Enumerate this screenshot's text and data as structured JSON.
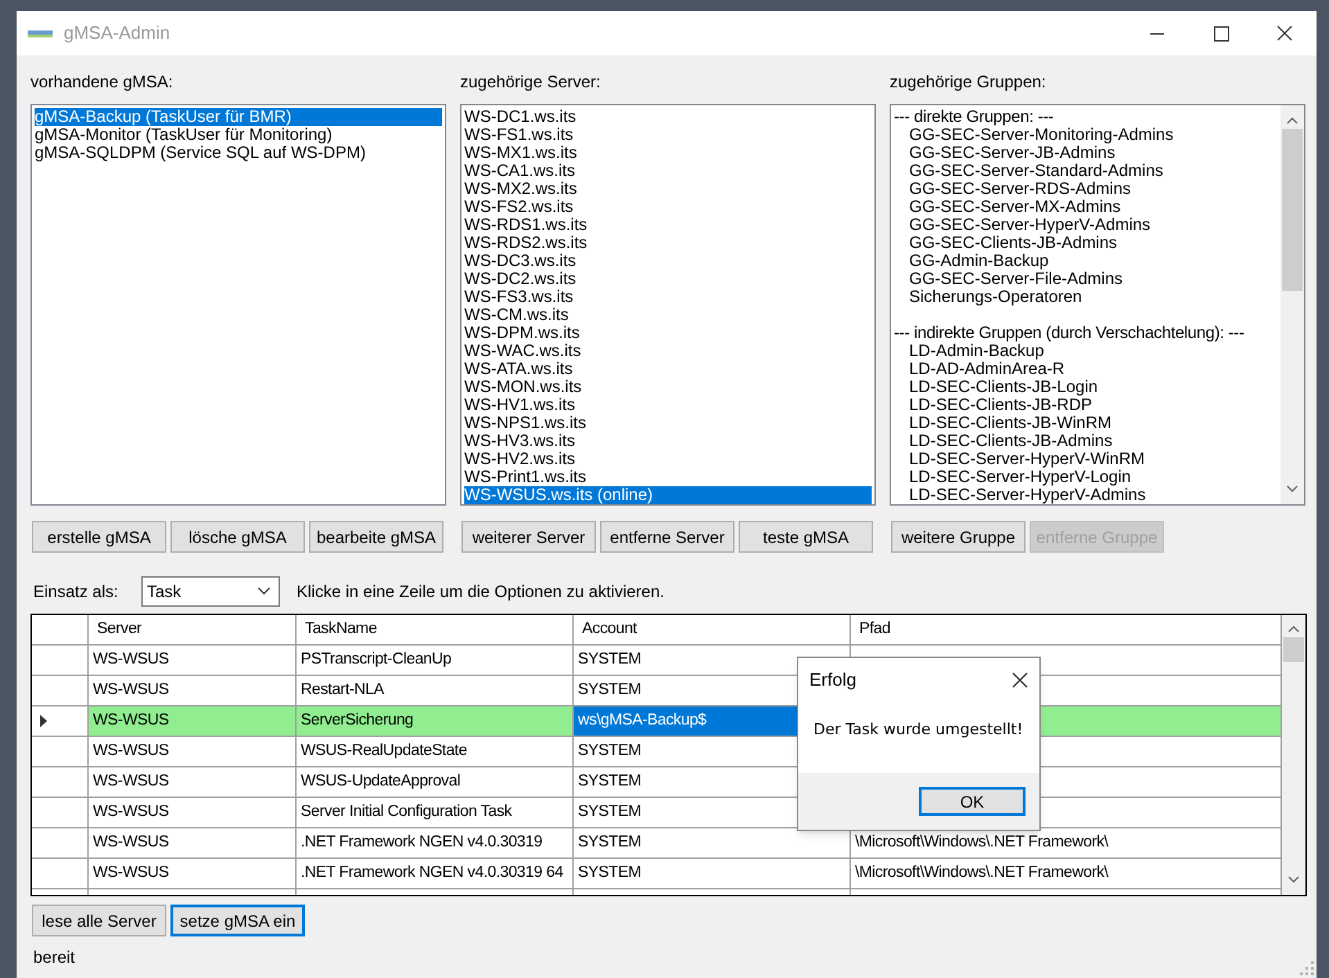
{
  "window": {
    "title": "gMSA-Admin"
  },
  "gmsa_panel": {
    "label": "vorhandene gMSA:",
    "items": [
      {
        "text": "gMSA-Backup (TaskUser für BMR)",
        "selected": true
      },
      {
        "text": "gMSA-Monitor (TaskUser für Monitoring)",
        "selected": false
      },
      {
        "text": "gMSA-SQLDPM (Service SQL auf WS-DPM)",
        "selected": false
      }
    ]
  },
  "servers_panel": {
    "label": "zugehörige Server:",
    "items": [
      {
        "text": "WS-DC1.ws.its",
        "selected": false
      },
      {
        "text": "WS-FS1.ws.its",
        "selected": false
      },
      {
        "text": "WS-MX1.ws.its",
        "selected": false
      },
      {
        "text": "WS-CA1.ws.its",
        "selected": false
      },
      {
        "text": "WS-MX2.ws.its",
        "selected": false
      },
      {
        "text": "WS-FS2.ws.its",
        "selected": false
      },
      {
        "text": "WS-RDS1.ws.its",
        "selected": false
      },
      {
        "text": "WS-RDS2.ws.its",
        "selected": false
      },
      {
        "text": "WS-DC3.ws.its",
        "selected": false
      },
      {
        "text": "WS-DC2.ws.its",
        "selected": false
      },
      {
        "text": "WS-FS3.ws.its",
        "selected": false
      },
      {
        "text": "WS-CM.ws.its",
        "selected": false
      },
      {
        "text": "WS-DPM.ws.its",
        "selected": false
      },
      {
        "text": "WS-WAC.ws.its",
        "selected": false
      },
      {
        "text": "WS-ATA.ws.its",
        "selected": false
      },
      {
        "text": "WS-MON.ws.its",
        "selected": false
      },
      {
        "text": "WS-HV1.ws.its",
        "selected": false
      },
      {
        "text": "WS-NPS1.ws.its",
        "selected": false
      },
      {
        "text": "WS-HV3.ws.its",
        "selected": false
      },
      {
        "text": "WS-HV2.ws.its",
        "selected": false
      },
      {
        "text": "WS-Print1.ws.its",
        "selected": false
      },
      {
        "text": "WS-WSUS.ws.its (online)",
        "selected": true
      }
    ]
  },
  "groups_panel": {
    "label": "zugehörige Gruppen:",
    "sections": [
      {
        "heading": "--- direkte Gruppen: ---",
        "groups": [
          "GG-SEC-Server-Monitoring-Admins",
          "GG-SEC-Server-JB-Admins",
          "GG-SEC-Server-Standard-Admins",
          "GG-SEC-Server-RDS-Admins",
          "GG-SEC-Server-MX-Admins",
          "GG-SEC-Server-HyperV-Admins",
          "GG-SEC-Clients-JB-Admins",
          "GG-Admin-Backup",
          "GG-SEC-Server-File-Admins",
          "Sicherungs-Operatoren"
        ]
      },
      {
        "heading": "--- indirekte Gruppen (durch Verschachtelung): ---",
        "groups": [
          "LD-Admin-Backup",
          "LD-AD-AdminArea-R",
          "LD-SEC-Clients-JB-Login",
          "LD-SEC-Clients-JB-RDP",
          "LD-SEC-Clients-JB-WinRM",
          "LD-SEC-Clients-JB-Admins",
          "LD-SEC-Server-HyperV-WinRM",
          "LD-SEC-Server-HyperV-Login",
          "LD-SEC-Server-HyperV-Admins"
        ]
      }
    ]
  },
  "gmsa_buttons": [
    {
      "label": "erstelle gMSA",
      "disabled": false
    },
    {
      "label": "lösche gMSA",
      "disabled": false
    },
    {
      "label": "bearbeite gMSA",
      "disabled": false
    }
  ],
  "server_buttons": [
    {
      "label": "weiterer Server",
      "disabled": false
    },
    {
      "label": "entferne Server",
      "disabled": false
    },
    {
      "label": "teste gMSA",
      "disabled": false
    }
  ],
  "group_buttons": [
    {
      "label": "weitere Gruppe",
      "disabled": false
    },
    {
      "label": "entferne Gruppe",
      "disabled": true
    }
  ],
  "usage": {
    "label": "Einsatz als:",
    "value": "Task",
    "hint": "Klicke in eine Zeile um die Optionen zu aktivieren."
  },
  "table": {
    "columns": [
      "Server",
      "TaskName",
      "Account",
      "Pfad"
    ],
    "rows": [
      {
        "server": "WS-WSUS",
        "task": "PSTranscript-CleanUp",
        "account": "SYSTEM",
        "selected": false,
        "account_focused": false
      },
      {
        "server": "WS-WSUS",
        "task": "Restart-NLA",
        "account": "SYSTEM",
        "selected": false,
        "account_focused": false
      },
      {
        "server": "WS-WSUS",
        "task": "ServerSicherung",
        "account": "ws\\gMSA-Backup$",
        "selected": true,
        "account_focused": true
      },
      {
        "server": "WS-WSUS",
        "task": "WSUS-RealUpdateState",
        "account": "SYSTEM",
        "selected": false,
        "account_focused": false
      },
      {
        "server": "WS-WSUS",
        "task": "WSUS-UpdateApproval",
        "account": "SYSTEM",
        "selected": false,
        "account_focused": false
      },
      {
        "server": "WS-WSUS",
        "task": "Server Initial Configuration Task",
        "account": "SYSTEM",
        "selected": false,
        "account_focused": false
      },
      {
        "server": "WS-WSUS",
        "task": ".NET Framework NGEN v4.0.30319",
        "account": "SYSTEM",
        "path": "\\Microsoft\\Windows\\.NET Framework\\",
        "selected": false,
        "account_focused": false
      },
      {
        "server": "WS-WSUS",
        "task": ".NET Framework NGEN v4.0.30319 64",
        "account": "SYSTEM",
        "path": "\\Microsoft\\Windows\\.NET Framework\\",
        "selected": false,
        "account_focused": false
      }
    ]
  },
  "bottom_buttons": [
    {
      "label": "lese alle Server",
      "focused": false
    },
    {
      "label": "setze gMSA ein",
      "focused": true
    }
  ],
  "status_bar": {
    "text": "bereit"
  },
  "dialog": {
    "title": "Erfolg",
    "message": "Der Task wurde umgestellt!",
    "button": {
      "label": "OK",
      "focused": true
    }
  }
}
